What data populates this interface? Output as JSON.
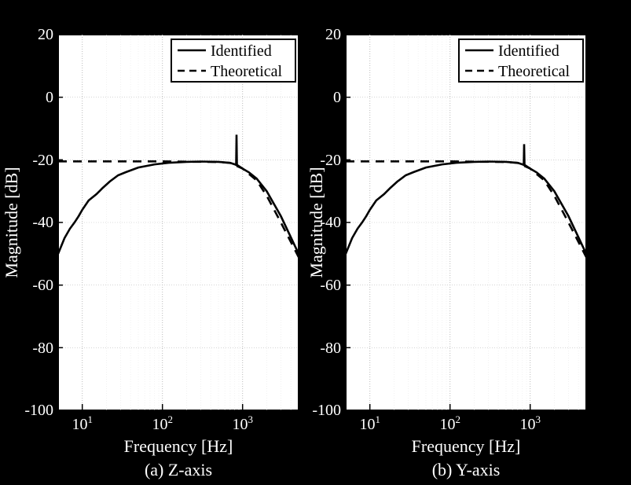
{
  "chart_data": [
    {
      "type": "line",
      "title": "",
      "subplot_label": "(a) Z-axis",
      "xlabel": "Frequency [Hz]",
      "ylabel": "Magnitude [dB]",
      "xscale": "log",
      "xlim": [
        5,
        5000
      ],
      "ylim": [
        -100,
        20
      ],
      "yticks": [
        -100,
        -80,
        -60,
        -40,
        -20,
        0,
        20
      ],
      "xticks": [
        10,
        100,
        1000
      ],
      "xtick_labels": [
        "10^1",
        "10^2",
        "10^3"
      ],
      "legend": {
        "entries": [
          "Identified",
          "Theoretical"
        ],
        "position": "top-right"
      },
      "grid": true,
      "series": [
        {
          "name": "Identified",
          "style": "solid",
          "x": [
            5,
            6,
            7,
            8,
            9,
            10,
            12,
            15,
            18,
            22,
            28,
            35,
            50,
            80,
            120,
            200,
            300,
            500,
            700,
            800,
            830,
            840,
            850,
            860,
            900,
            1000,
            1200,
            1500,
            2000,
            3000,
            5000
          ],
          "y": [
            -50,
            -45,
            -42,
            -40,
            -38,
            -36,
            -33,
            -31,
            -29,
            -27,
            -25,
            -24,
            -22.5,
            -21.5,
            -21,
            -20.7,
            -20.6,
            -20.7,
            -21.0,
            -21.5,
            -21.7,
            -12,
            -21.8,
            -22,
            -22.2,
            -22.8,
            -24,
            -26,
            -30,
            -38,
            -50
          ]
        },
        {
          "name": "Theoretical",
          "style": "dashed",
          "x": [
            5,
            10,
            20,
            50,
            100,
            200,
            500,
            700,
            1000,
            1500,
            2000,
            3000,
            5000
          ],
          "y": [
            -20.5,
            -20.5,
            -20.5,
            -20.5,
            -20.5,
            -20.6,
            -20.7,
            -21.0,
            -22.8,
            -26.5,
            -31.5,
            -40,
            -52
          ]
        }
      ]
    },
    {
      "type": "line",
      "title": "",
      "subplot_label": "(b) Y-axis",
      "xlabel": "Frequency [Hz]",
      "ylabel": "Magnitude [dB]",
      "xscale": "log",
      "xlim": [
        5,
        5000
      ],
      "ylim": [
        -100,
        20
      ],
      "yticks": [
        -100,
        -80,
        -60,
        -40,
        -20,
        0,
        20
      ],
      "xticks": [
        10,
        100,
        1000
      ],
      "xtick_labels": [
        "10^1",
        "10^2",
        "10^3"
      ],
      "legend": {
        "entries": [
          "Identified",
          "Theoretical"
        ],
        "position": "top-right"
      },
      "grid": true,
      "series": [
        {
          "name": "Identified",
          "style": "solid",
          "x": [
            5,
            6,
            7,
            8,
            9,
            10,
            12,
            15,
            18,
            22,
            28,
            35,
            50,
            80,
            120,
            200,
            300,
            500,
            700,
            800,
            830,
            840,
            850,
            860,
            900,
            1000,
            1200,
            1500,
            2000,
            3000,
            5000
          ],
          "y": [
            -50,
            -45,
            -42,
            -40,
            -38,
            -36,
            -33,
            -31,
            -29,
            -27,
            -25,
            -24,
            -22.5,
            -21.5,
            -21,
            -20.7,
            -20.6,
            -20.7,
            -21.0,
            -21.5,
            -21.7,
            -15,
            -21.8,
            -22,
            -22.2,
            -22.8,
            -24,
            -26,
            -30,
            -38,
            -50
          ]
        },
        {
          "name": "Theoretical",
          "style": "dashed",
          "x": [
            5,
            10,
            20,
            50,
            100,
            200,
            500,
            700,
            1000,
            1500,
            2000,
            3000,
            5000
          ],
          "y": [
            -20.5,
            -20.5,
            -20.5,
            -20.5,
            -20.5,
            -20.6,
            -20.7,
            -21.0,
            -22.8,
            -26.5,
            -31.5,
            -40,
            -52
          ]
        }
      ]
    }
  ],
  "labels": {
    "ylabel": "Magnitude [dB]",
    "xlabel": "Frequency [Hz]",
    "sub_a": "(a) Z-axis",
    "sub_b": "(b) Y-axis",
    "legend_identified": "Identified",
    "legend_theoretical": "Theoretical"
  }
}
